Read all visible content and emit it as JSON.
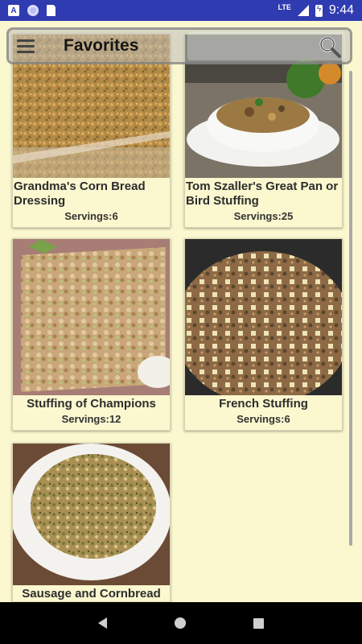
{
  "status_bar": {
    "network": "LTE",
    "time": "9:44",
    "icons": [
      "a-notification-icon",
      "circle-notification-icon",
      "sd-card-icon",
      "signal-icon",
      "battery-charging-icon"
    ]
  },
  "toolbar": {
    "title": "Favorites",
    "menu_icon": "hamburger-menu-icon",
    "search_icon": "search-icon"
  },
  "recipes": [
    {
      "title": "Grandma's Corn Bread Dressing",
      "servings": "Servings:6"
    },
    {
      "title": "Tom Szaller's Great Pan or Bird Stuffing",
      "servings": "Servings:25"
    },
    {
      "title": "Stuffing of Champions",
      "servings": "Servings:12"
    },
    {
      "title": "French Stuffing",
      "servings": "Servings:6"
    },
    {
      "title": "Sausage and Cornbread",
      "servings": ""
    }
  ],
  "nav_bar": {
    "icons": [
      "back-icon",
      "home-icon",
      "recents-icon"
    ]
  }
}
